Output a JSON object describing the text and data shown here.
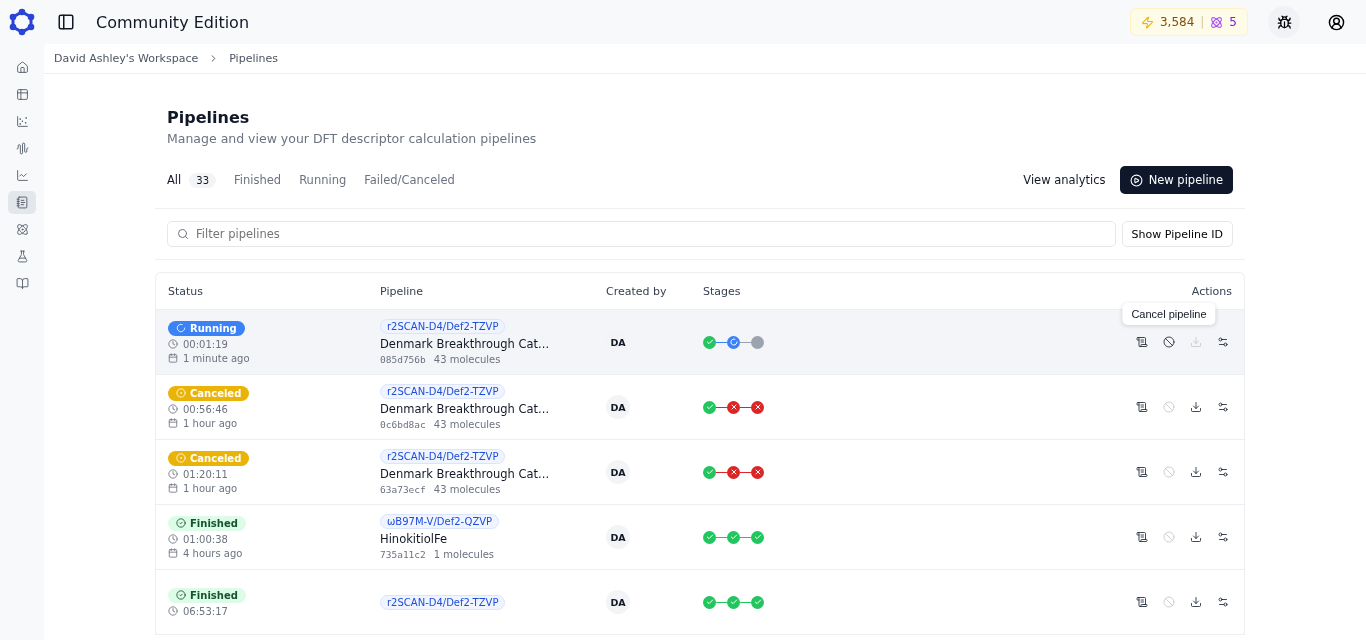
{
  "header": {
    "title": "Community Edition",
    "credits": "3,584",
    "separator": "|",
    "tokens": "5"
  },
  "sidebar": {
    "items": [
      {
        "kind": "home",
        "selected": false
      },
      {
        "kind": "table",
        "selected": false
      },
      {
        "kind": "scatter",
        "selected": false
      },
      {
        "kind": "wave",
        "selected": false
      },
      {
        "kind": "line",
        "selected": false
      },
      {
        "kind": "notes",
        "selected": true
      },
      {
        "kind": "atom",
        "selected": false
      },
      {
        "kind": "flask",
        "selected": false
      },
      {
        "kind": "book",
        "selected": false
      }
    ]
  },
  "breadcrumb": [
    "David Ashley's Workspace",
    "Pipelines"
  ],
  "page": {
    "title": "Pipelines",
    "subtitle": "Manage and view your DFT descriptor calculation pipelines"
  },
  "tabs": [
    {
      "label": "All",
      "count": "33",
      "selected": true
    },
    {
      "label": "Finished",
      "selected": false
    },
    {
      "label": "Running",
      "selected": false
    },
    {
      "label": "Failed/Canceled",
      "selected": false
    }
  ],
  "buttons": {
    "analytics": "View analytics",
    "new": "New pipeline",
    "show_id": "Show Pipeline ID"
  },
  "search": {
    "placeholder": "Filter pipelines"
  },
  "table": {
    "columns": [
      "Status",
      "Pipeline",
      "Created by",
      "Stages",
      "Actions"
    ],
    "rows": [
      {
        "status": {
          "kind": "running",
          "label": "Running"
        },
        "duration": "00:01:19",
        "created": "1 minute ago",
        "method": "r2SCAN-D4/Def2-TZVP",
        "name": "Denmark Breakthrough Cat...",
        "hash": "085d756b",
        "molecules": "43 molecules",
        "creator": "DA",
        "hovered": true,
        "stages": [
          {
            "kind": "done"
          },
          {
            "kind": "running"
          },
          {
            "kind": "pending"
          }
        ],
        "actions": [
          {
            "kind": "logs",
            "disabled": false
          },
          {
            "kind": "cancel",
            "disabled": false,
            "tooltip": "Cancel pipeline"
          },
          {
            "kind": "download",
            "disabled": true
          },
          {
            "kind": "settings",
            "disabled": false
          }
        ]
      },
      {
        "status": {
          "kind": "canceled",
          "label": "Canceled"
        },
        "duration": "00:56:46",
        "created": "1 hour ago",
        "method": "r2SCAN-D4/Def2-TZVP",
        "name": "Denmark Breakthrough Cat...",
        "hash": "0c6bd8ac",
        "molecules": "43 molecules",
        "creator": "DA",
        "hovered": false,
        "stages": [
          {
            "kind": "done"
          },
          {
            "kind": "failed"
          },
          {
            "kind": "failed"
          }
        ],
        "actions": [
          {
            "kind": "logs",
            "disabled": false
          },
          {
            "kind": "cancel",
            "disabled": true
          },
          {
            "kind": "download",
            "disabled": false
          },
          {
            "kind": "settings",
            "disabled": false
          }
        ]
      },
      {
        "status": {
          "kind": "canceled",
          "label": "Canceled"
        },
        "duration": "01:20:11",
        "created": "1 hour ago",
        "method": "r2SCAN-D4/Def2-TZVP",
        "name": "Denmark Breakthrough Cat...",
        "hash": "63a73ecf",
        "molecules": "43 molecules",
        "creator": "DA",
        "hovered": false,
        "stages": [
          {
            "kind": "done"
          },
          {
            "kind": "failed"
          },
          {
            "kind": "failed"
          }
        ],
        "actions": [
          {
            "kind": "logs",
            "disabled": false
          },
          {
            "kind": "cancel",
            "disabled": true
          },
          {
            "kind": "download",
            "disabled": false
          },
          {
            "kind": "settings",
            "disabled": false
          }
        ]
      },
      {
        "status": {
          "kind": "finished",
          "label": "Finished"
        },
        "duration": "01:00:38",
        "created": "4 hours ago",
        "method": "ωB97M-V/Def2-QZVP",
        "name": "HinokitiolFe",
        "hash": "735a11c2",
        "molecules": "1 molecules",
        "creator": "DA",
        "hovered": false,
        "stages": [
          {
            "kind": "done"
          },
          {
            "kind": "done"
          },
          {
            "kind": "done"
          }
        ],
        "actions": [
          {
            "kind": "logs",
            "disabled": false
          },
          {
            "kind": "cancel",
            "disabled": true
          },
          {
            "kind": "download",
            "disabled": false
          },
          {
            "kind": "settings",
            "disabled": false
          }
        ]
      },
      {
        "status": {
          "kind": "finished",
          "label": "Finished"
        },
        "duration": "06:53:17",
        "method": "r2SCAN-D4/Def2-TZVP",
        "creator": "DA",
        "hovered": false,
        "stages": [
          {
            "kind": "done"
          },
          {
            "kind": "done"
          },
          {
            "kind": "done"
          }
        ],
        "actions": [
          {
            "kind": "logs",
            "disabled": false
          },
          {
            "kind": "cancel",
            "disabled": true
          },
          {
            "kind": "download",
            "disabled": false
          },
          {
            "kind": "settings",
            "disabled": false
          }
        ]
      }
    ]
  }
}
